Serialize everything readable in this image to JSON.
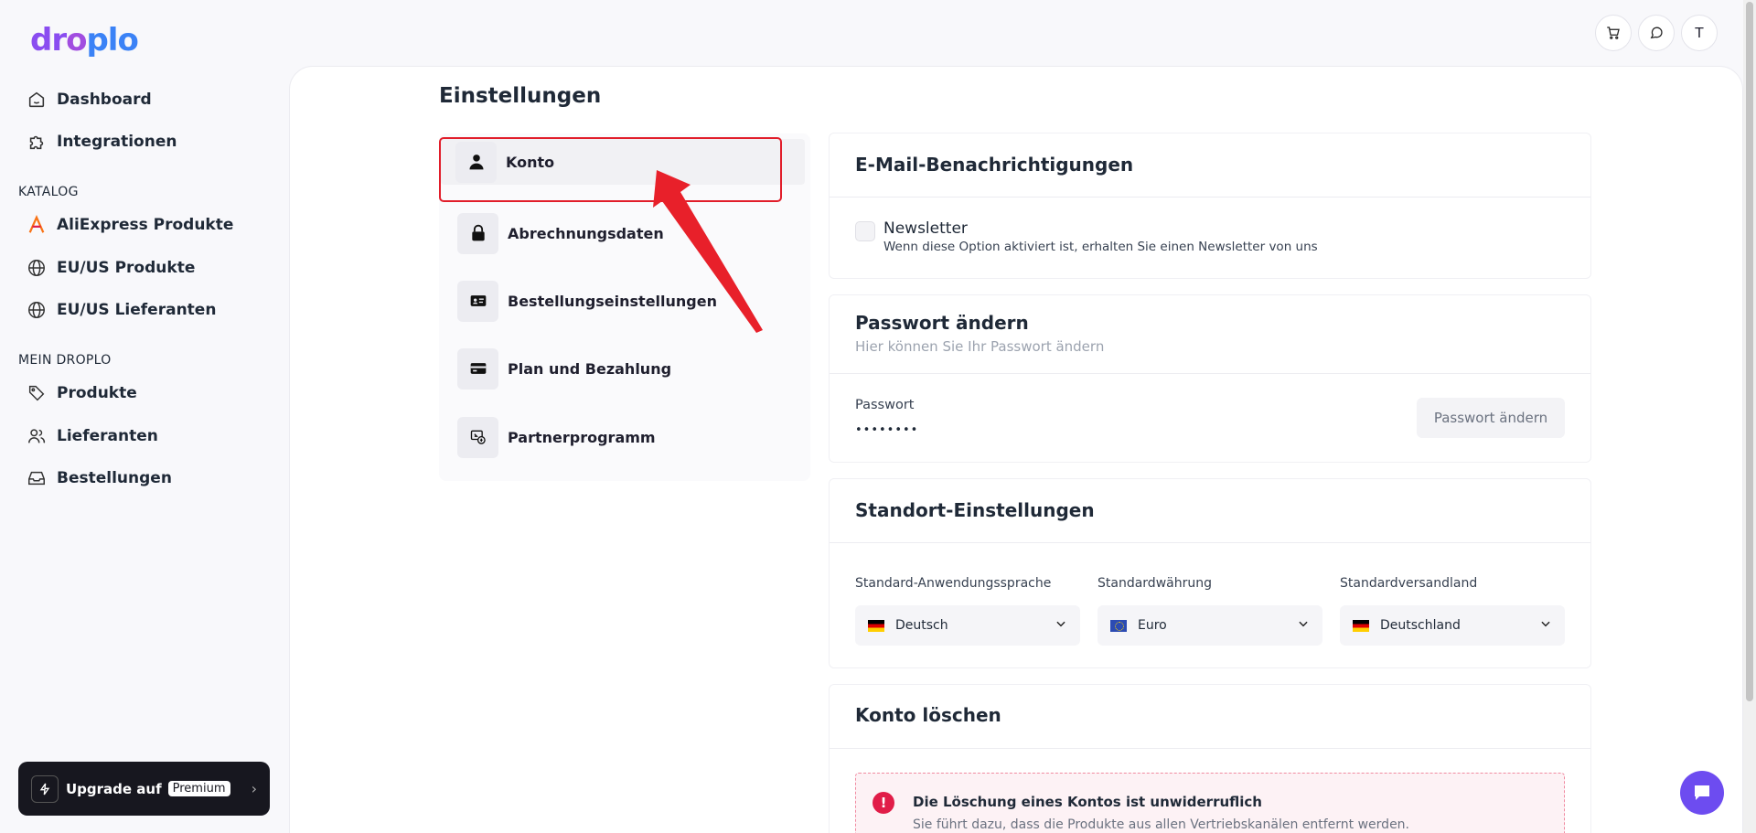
{
  "brand": {
    "logo_part1": "dr",
    "logo_part2": "o",
    "logo_part3": "plo"
  },
  "sidebar": {
    "items_top": [
      {
        "label": "Dashboard",
        "icon": "home-icon"
      },
      {
        "label": "Integrationen",
        "icon": "puzzle-icon"
      }
    ],
    "katalog_label": "KATALOG",
    "katalog_items": [
      {
        "label": "AliExpress Produkte",
        "icon": "aliexpress-icon"
      },
      {
        "label": "EU/US Produkte",
        "icon": "globe-icon"
      },
      {
        "label": "EU/US Lieferanten",
        "icon": "globe-icon"
      }
    ],
    "mein_label": "MEIN DROPLO",
    "mein_items": [
      {
        "label": "Produkte",
        "icon": "tag-icon"
      },
      {
        "label": "Lieferanten",
        "icon": "users-icon"
      },
      {
        "label": "Bestellungen",
        "icon": "inbox-icon"
      }
    ],
    "upgrade": {
      "label": "Upgrade auf",
      "badge": "Premium"
    }
  },
  "topbar": {
    "avatar_initial": "T"
  },
  "page": {
    "title": "Einstellungen"
  },
  "settings_menu": [
    {
      "label": "Konto",
      "icon": "user-icon",
      "active": true
    },
    {
      "label": "Abrechnungsdaten",
      "icon": "lock-icon"
    },
    {
      "label": "Bestellungseinstellungen",
      "icon": "id-card-icon"
    },
    {
      "label": "Plan und Bezahlung",
      "icon": "credit-card-icon"
    },
    {
      "label": "Partnerprogramm",
      "icon": "partner-icon"
    }
  ],
  "email_card": {
    "title": "E-Mail-Benachrichtigungen",
    "newsletter_label": "Newsletter",
    "newsletter_desc": "Wenn diese Option aktiviert ist, erhalten Sie einen Newsletter von uns",
    "newsletter_checked": false
  },
  "password_card": {
    "title": "Passwort ändern",
    "subtitle": "Hier können Sie Ihr Passwort ändern",
    "field_label": "Passwort",
    "field_value": "••••••••",
    "button": "Passwort ändern"
  },
  "location_card": {
    "title": "Standort-Einstellungen",
    "language_label": "Standard-Anwendungssprache",
    "language_value": "Deutsch",
    "currency_label": "Standardwährung",
    "currency_value": "Euro",
    "country_label": "Standardversandland",
    "country_value": "Deutschland"
  },
  "delete_card": {
    "title": "Konto löschen",
    "warning_title": "Die Löschung eines Kontos ist unwiderruflich",
    "warning_text": "Sie führt dazu, dass die Produkte aus allen Vertriebskanälen entfernt werden."
  },
  "colors": {
    "accent": "#6d4cf0",
    "danger": "#e11d48",
    "highlight_box": "#e11d2a"
  }
}
